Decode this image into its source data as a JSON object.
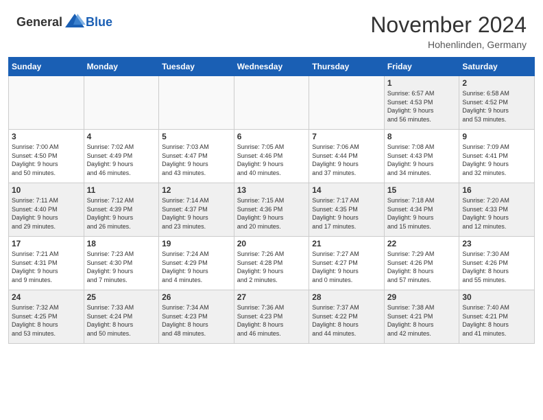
{
  "header": {
    "logo_general": "General",
    "logo_blue": "Blue",
    "month_year": "November 2024",
    "location": "Hohenlinden, Germany"
  },
  "weekdays": [
    "Sunday",
    "Monday",
    "Tuesday",
    "Wednesday",
    "Thursday",
    "Friday",
    "Saturday"
  ],
  "weeks": [
    [
      {
        "day": "",
        "info": ""
      },
      {
        "day": "",
        "info": ""
      },
      {
        "day": "",
        "info": ""
      },
      {
        "day": "",
        "info": ""
      },
      {
        "day": "",
        "info": ""
      },
      {
        "day": "1",
        "info": "Sunrise: 6:57 AM\nSunset: 4:53 PM\nDaylight: 9 hours\nand 56 minutes."
      },
      {
        "day": "2",
        "info": "Sunrise: 6:58 AM\nSunset: 4:52 PM\nDaylight: 9 hours\nand 53 minutes."
      }
    ],
    [
      {
        "day": "3",
        "info": "Sunrise: 7:00 AM\nSunset: 4:50 PM\nDaylight: 9 hours\nand 50 minutes."
      },
      {
        "day": "4",
        "info": "Sunrise: 7:02 AM\nSunset: 4:49 PM\nDaylight: 9 hours\nand 46 minutes."
      },
      {
        "day": "5",
        "info": "Sunrise: 7:03 AM\nSunset: 4:47 PM\nDaylight: 9 hours\nand 43 minutes."
      },
      {
        "day": "6",
        "info": "Sunrise: 7:05 AM\nSunset: 4:46 PM\nDaylight: 9 hours\nand 40 minutes."
      },
      {
        "day": "7",
        "info": "Sunrise: 7:06 AM\nSunset: 4:44 PM\nDaylight: 9 hours\nand 37 minutes."
      },
      {
        "day": "8",
        "info": "Sunrise: 7:08 AM\nSunset: 4:43 PM\nDaylight: 9 hours\nand 34 minutes."
      },
      {
        "day": "9",
        "info": "Sunrise: 7:09 AM\nSunset: 4:41 PM\nDaylight: 9 hours\nand 32 minutes."
      }
    ],
    [
      {
        "day": "10",
        "info": "Sunrise: 7:11 AM\nSunset: 4:40 PM\nDaylight: 9 hours\nand 29 minutes."
      },
      {
        "day": "11",
        "info": "Sunrise: 7:12 AM\nSunset: 4:39 PM\nDaylight: 9 hours\nand 26 minutes."
      },
      {
        "day": "12",
        "info": "Sunrise: 7:14 AM\nSunset: 4:37 PM\nDaylight: 9 hours\nand 23 minutes."
      },
      {
        "day": "13",
        "info": "Sunrise: 7:15 AM\nSunset: 4:36 PM\nDaylight: 9 hours\nand 20 minutes."
      },
      {
        "day": "14",
        "info": "Sunrise: 7:17 AM\nSunset: 4:35 PM\nDaylight: 9 hours\nand 17 minutes."
      },
      {
        "day": "15",
        "info": "Sunrise: 7:18 AM\nSunset: 4:34 PM\nDaylight: 9 hours\nand 15 minutes."
      },
      {
        "day": "16",
        "info": "Sunrise: 7:20 AM\nSunset: 4:33 PM\nDaylight: 9 hours\nand 12 minutes."
      }
    ],
    [
      {
        "day": "17",
        "info": "Sunrise: 7:21 AM\nSunset: 4:31 PM\nDaylight: 9 hours\nand 9 minutes."
      },
      {
        "day": "18",
        "info": "Sunrise: 7:23 AM\nSunset: 4:30 PM\nDaylight: 9 hours\nand 7 minutes."
      },
      {
        "day": "19",
        "info": "Sunrise: 7:24 AM\nSunset: 4:29 PM\nDaylight: 9 hours\nand 4 minutes."
      },
      {
        "day": "20",
        "info": "Sunrise: 7:26 AM\nSunset: 4:28 PM\nDaylight: 9 hours\nand 2 minutes."
      },
      {
        "day": "21",
        "info": "Sunrise: 7:27 AM\nSunset: 4:27 PM\nDaylight: 9 hours\nand 0 minutes."
      },
      {
        "day": "22",
        "info": "Sunrise: 7:29 AM\nSunset: 4:26 PM\nDaylight: 8 hours\nand 57 minutes."
      },
      {
        "day": "23",
        "info": "Sunrise: 7:30 AM\nSunset: 4:26 PM\nDaylight: 8 hours\nand 55 minutes."
      }
    ],
    [
      {
        "day": "24",
        "info": "Sunrise: 7:32 AM\nSunset: 4:25 PM\nDaylight: 8 hours\nand 53 minutes."
      },
      {
        "day": "25",
        "info": "Sunrise: 7:33 AM\nSunset: 4:24 PM\nDaylight: 8 hours\nand 50 minutes."
      },
      {
        "day": "26",
        "info": "Sunrise: 7:34 AM\nSunset: 4:23 PM\nDaylight: 8 hours\nand 48 minutes."
      },
      {
        "day": "27",
        "info": "Sunrise: 7:36 AM\nSunset: 4:23 PM\nDaylight: 8 hours\nand 46 minutes."
      },
      {
        "day": "28",
        "info": "Sunrise: 7:37 AM\nSunset: 4:22 PM\nDaylight: 8 hours\nand 44 minutes."
      },
      {
        "day": "29",
        "info": "Sunrise: 7:38 AM\nSunset: 4:21 PM\nDaylight: 8 hours\nand 42 minutes."
      },
      {
        "day": "30",
        "info": "Sunrise: 7:40 AM\nSunset: 4:21 PM\nDaylight: 8 hours\nand 41 minutes."
      }
    ]
  ]
}
